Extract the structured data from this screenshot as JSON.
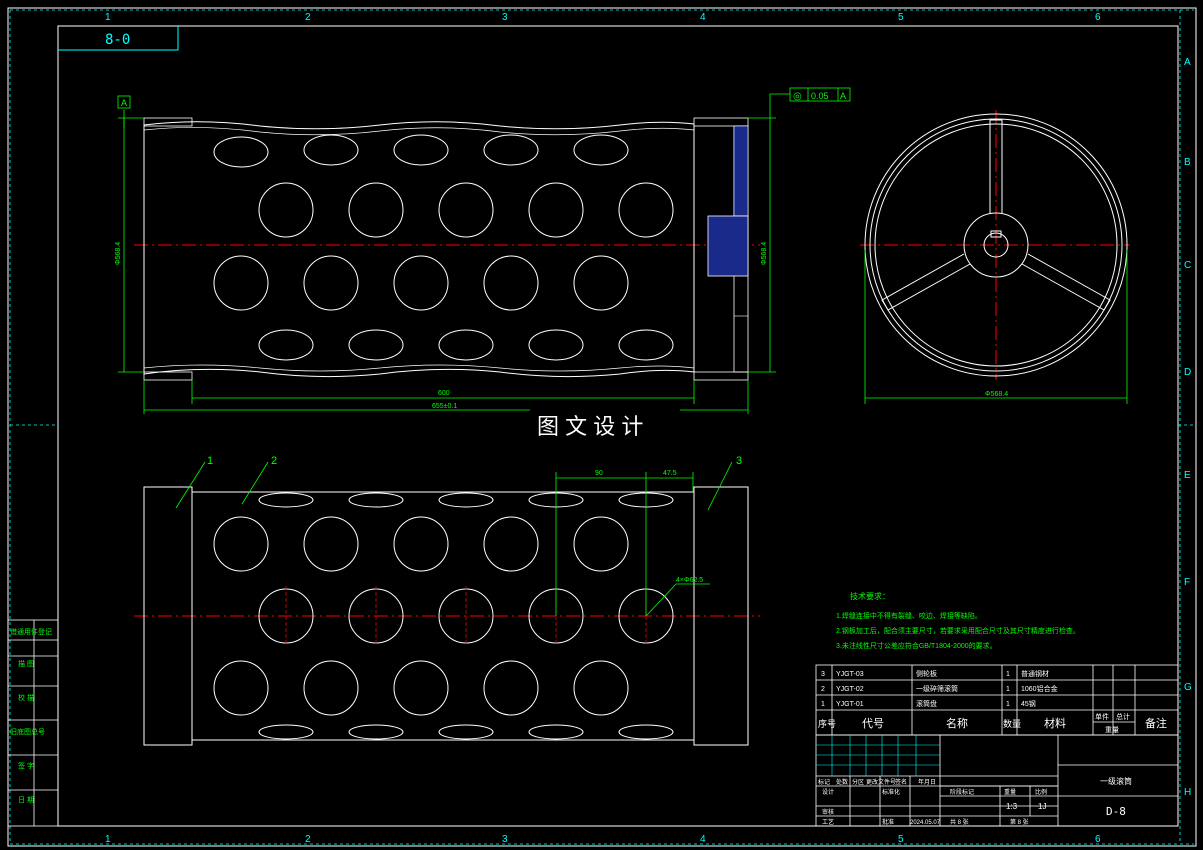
{
  "drawing_code_box": "8-0",
  "top_zone_numbers": [
    "1",
    "2",
    "3",
    "4",
    "5",
    "6"
  ],
  "bottom_zone_numbers": [
    "1",
    "2",
    "3",
    "4",
    "5",
    "6"
  ],
  "right_zone_letters": [
    "A",
    "B",
    "C",
    "D",
    "E",
    "F",
    "G",
    "H"
  ],
  "datum_label": "A",
  "tolerance_frame": {
    "symbol": "◎",
    "value": "0.05",
    "datum": "A"
  },
  "dims": {
    "length_inner": "600",
    "length_total": "655±0.1",
    "diameter_left": "Φ568.4",
    "diameter_right": "Φ568.4",
    "diameter_side": "Φ568.4",
    "pitch": "90",
    "offset": "47.5",
    "hole": "4×Φ62.5"
  },
  "watermark": "图 文 设 计",
  "balloons": [
    "1",
    "2",
    "3"
  ],
  "notes": {
    "title": "技术要求：",
    "lines": [
      "1.焊缝连接中不得有裂缝、咬边、焊接等缺陷。",
      "2.钢板加工后，配合须主要尺寸，若要求采用配合尺寸及其尺寸精度进行检查。",
      "3.未注线性尺寸公差应符合GB/T1804-2000的要求。"
    ]
  },
  "bom": {
    "rows": [
      {
        "no": "3",
        "code": "YJGT-03",
        "name": "侧轮板",
        "qty": "1",
        "material": "普通钢材"
      },
      {
        "no": "2",
        "code": "YJGT-02",
        "name": "一级碎筛滚筒",
        "qty": "1",
        "material": "1060铝合金"
      },
      {
        "no": "1",
        "code": "YJGT-01",
        "name": "滚筒盘",
        "qty": "1",
        "material": "45钢"
      }
    ],
    "headers": {
      "no": "序号",
      "code": "代号",
      "name": "名称",
      "qty": "数量",
      "material": "材料",
      "single": "单件",
      "total": "总计",
      "weight": "重量",
      "remark": "备注"
    }
  },
  "title_block": {
    "part_name": "一级滚筒",
    "drawing_no": "D-8",
    "scale": "1:3",
    "weight": "1J",
    "sheet_of": "共 8 张",
    "sheet_no": "第 8 张",
    "date": "2024.05.07",
    "labels": {
      "mark": "标记",
      "count": "处数",
      "zone": "分区",
      "change_doc": "更改文件号",
      "signature": "签名",
      "date_hdr": "年月日",
      "designer": "设计",
      "standardize": "标准化",
      "stage": "阶段标记",
      "weight_hdr": "重量",
      "scale_hdr": "比例",
      "review": "审核",
      "process": "工艺",
      "approve": "批准"
    }
  },
  "left_strip": [
    "借通用件登记",
    "描 图",
    "校 描",
    "旧底图总号",
    "签 字",
    "日 期"
  ]
}
